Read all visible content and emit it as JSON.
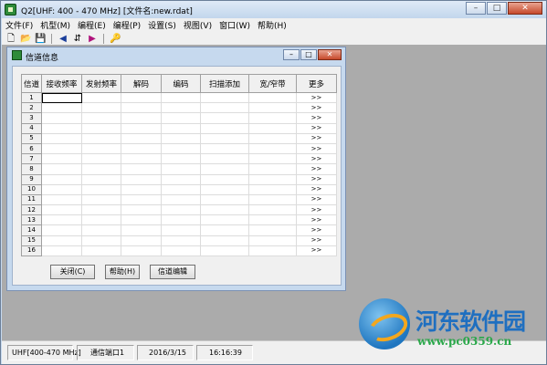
{
  "window": {
    "title": "Q2[UHF: 400 - 470 MHz] [文件名:new.rdat]",
    "min_glyph": "–",
    "max_glyph": "□",
    "close_glyph": "✕"
  },
  "menu": [
    "文件(F)",
    "机型(M)",
    "编程(E)",
    "编程(P)",
    "设置(S)",
    "视图(V)",
    "窗口(W)",
    "帮助(H)"
  ],
  "toolbar": {
    "icons": [
      "new-file-icon",
      "open-folder-icon",
      "save-icon",
      "read-arrow-icon",
      "write-device-icon",
      "write-arrow-icon",
      "key-icon"
    ],
    "glyphs": [
      "🗋",
      "📂",
      "💾",
      "◀",
      "⇵",
      "▶",
      "🔑"
    ]
  },
  "dialog": {
    "title": "信道信息",
    "min_glyph": "–",
    "max_glyph": "□",
    "close_glyph": "✕",
    "columns": [
      "信道",
      "接收频率",
      "发射频率",
      "解码",
      "编码",
      "扫描添加",
      "宽/窄带",
      "更多"
    ],
    "rows": [
      {
        "num": "1",
        "more": ">>"
      },
      {
        "num": "2",
        "more": ">>"
      },
      {
        "num": "3",
        "more": ">>"
      },
      {
        "num": "4",
        "more": ">>"
      },
      {
        "num": "5",
        "more": ">>"
      },
      {
        "num": "6",
        "more": ">>"
      },
      {
        "num": "7",
        "more": ">>"
      },
      {
        "num": "8",
        "more": ">>"
      },
      {
        "num": "9",
        "more": ">>"
      },
      {
        "num": "10",
        "more": ">>"
      },
      {
        "num": "11",
        "more": ">>"
      },
      {
        "num": "12",
        "more": ">>"
      },
      {
        "num": "13",
        "more": ">>"
      },
      {
        "num": "14",
        "more": ">>"
      },
      {
        "num": "15",
        "more": ">>"
      },
      {
        "num": "16",
        "more": ">>"
      }
    ],
    "buttons": {
      "close": "关闭(C)",
      "help": "帮助(H)",
      "edit": "信道编辑"
    }
  },
  "statusbar": {
    "band": "UHF[400-470 MHz]",
    "port": "通信端口1",
    "date": "2016/3/15",
    "time": "16:16:39"
  },
  "watermark": {
    "name": "河东软件园",
    "url": "www.pc0359.cn"
  }
}
